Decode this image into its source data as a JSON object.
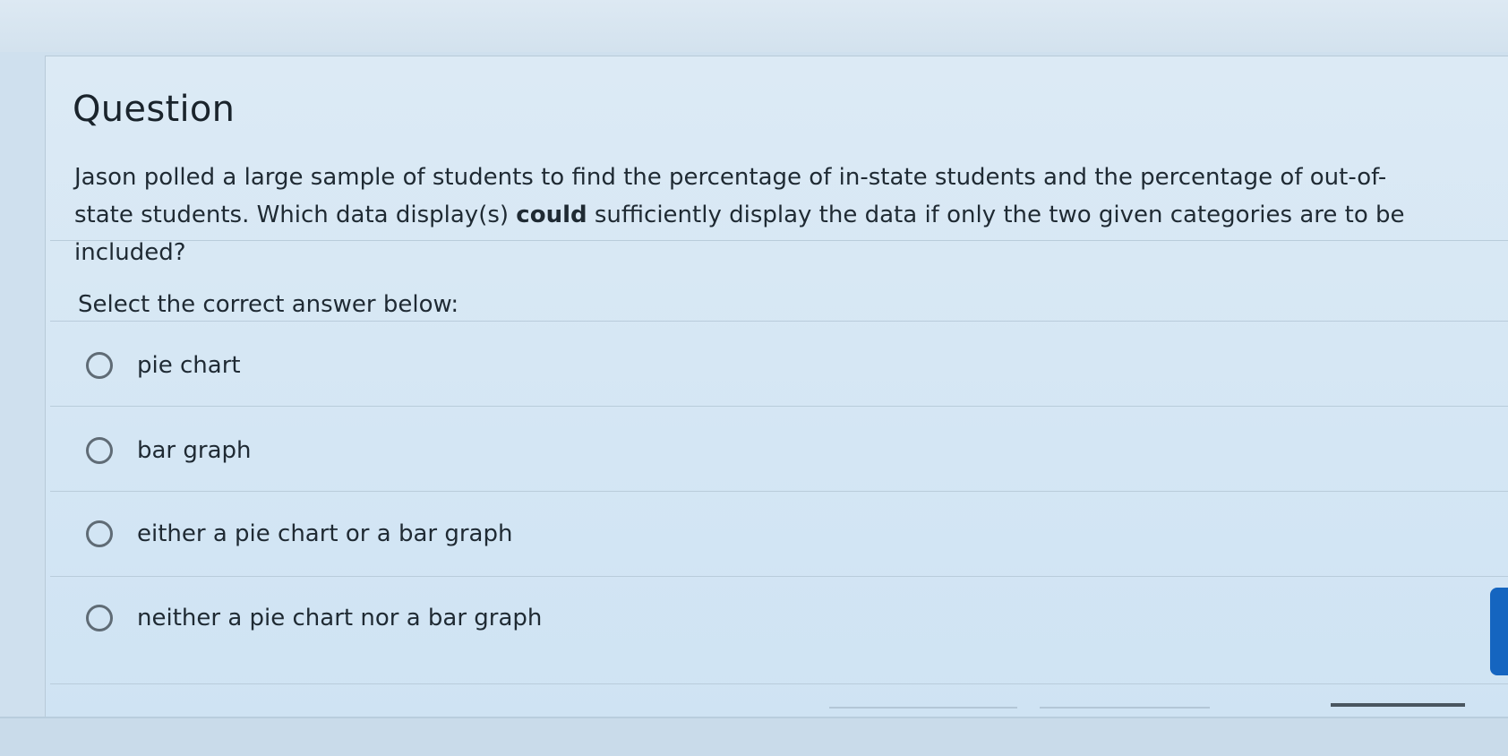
{
  "question": {
    "heading": "Question",
    "prompt_part1": "Jason polled a large sample of students to find the percentage of in-state students and the percentage of out-of-state students. Which data display(s) ",
    "prompt_emphasis": "could",
    "prompt_part2": " sufficiently display the data if only the two given categories are to be included?",
    "instruction": "Select the correct answer below:",
    "options": [
      {
        "label": "pie chart"
      },
      {
        "label": "bar graph"
      },
      {
        "label": "either a pie chart or a bar graph"
      },
      {
        "label": "neither a pie chart nor a bar graph"
      }
    ]
  },
  "colors": {
    "accent": "#1565c0",
    "card_background": "#d8e8f5",
    "text": "#1f2a33"
  }
}
